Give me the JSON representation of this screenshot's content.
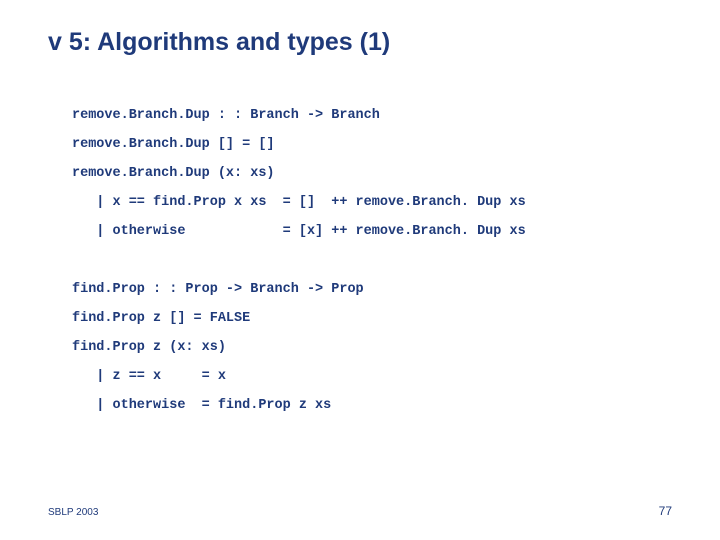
{
  "title": "v 5: Algorithms and types (1)",
  "code": "remove.Branch.Dup : : Branch -> Branch\nremove.Branch.Dup [] = []\nremove.Branch.Dup (x: xs)\n   | x == find.Prop x xs  = []  ++ remove.Branch. Dup xs\n   | otherwise            = [x] ++ remove.Branch. Dup xs\n\nfind.Prop : : Prop -> Branch -> Prop\nfind.Prop z [] = FALSE\nfind.Prop z (x: xs)\n   | z == x     = x\n   | otherwise  = find.Prop z xs",
  "footer": {
    "left": "SBLP 2003",
    "right": "77"
  }
}
